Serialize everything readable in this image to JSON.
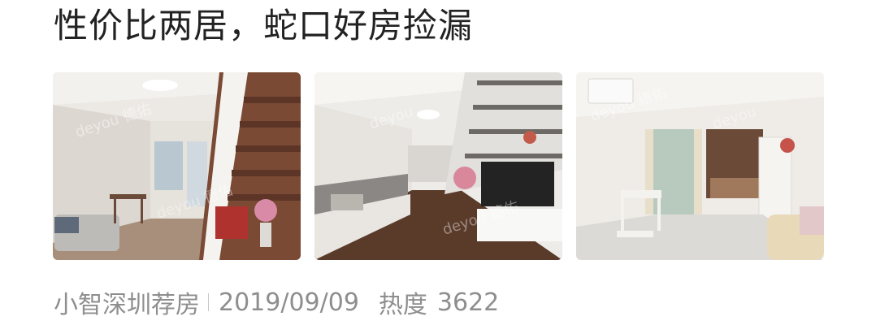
{
  "post": {
    "title": "性价比两居，蛇口好房捡漏",
    "images": [
      {
        "description": "loft-living-room-with-staircase",
        "watermark": "deyou 德佑"
      },
      {
        "description": "loft-living-room-sofa-and-tv",
        "watermark": "deyou 德佑"
      },
      {
        "description": "living-dining-kitchen-view",
        "watermark": "deyou 德佑"
      }
    ],
    "author": "小智深圳荐房",
    "date": "2019/09/09",
    "heat_label": "热度",
    "heat_value": "3622"
  },
  "colors": {
    "title": "#222222",
    "meta": "#8e8e8e",
    "background": "#ffffff"
  }
}
